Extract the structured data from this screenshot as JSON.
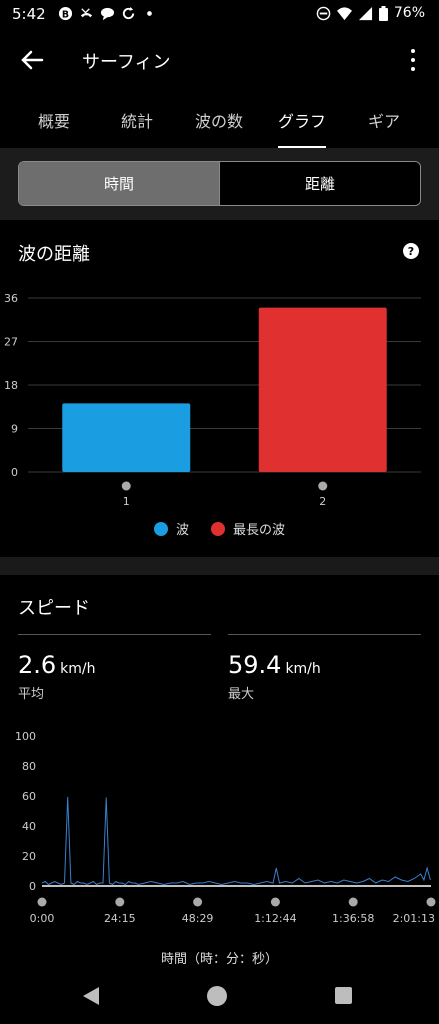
{
  "status_bar": {
    "time": "5:42",
    "battery": "76%",
    "left_icons": [
      "notification-b-icon",
      "missed-call-icon",
      "chat-icon",
      "sync-icon",
      "dot-icon"
    ],
    "right_icons": [
      "do-not-disturb-icon",
      "wifi-icon",
      "signal-icon",
      "battery-icon"
    ]
  },
  "app_bar": {
    "title": "サーフィン"
  },
  "tabs": [
    {
      "label": "概要"
    },
    {
      "label": "統計"
    },
    {
      "label": "波の数"
    },
    {
      "label": "グラフ",
      "active": true
    },
    {
      "label": "ギア"
    }
  ],
  "segmented": {
    "selected": "時間",
    "other": "距離"
  },
  "wave_distance": {
    "title": "波の距離",
    "chart_data": {
      "type": "bar",
      "categories": [
        "1",
        "2"
      ],
      "values": [
        14.2,
        34
      ],
      "ylim": [
        0,
        36
      ],
      "yticks": [
        "0",
        "9",
        "18",
        "27",
        "36"
      ],
      "colors": [
        "#1a9de1",
        "#e03030"
      ],
      "grid": true,
      "legend_position": "bottom"
    },
    "legend": [
      {
        "label": "波",
        "color": "#1a9de1"
      },
      {
        "label": "最長の波",
        "color": "#e03030"
      }
    ]
  },
  "speed": {
    "title": "スピード",
    "avg": {
      "value": "2.6",
      "unit": "km/h",
      "label": "平均"
    },
    "max": {
      "value": "59.4",
      "unit": "km/h",
      "label": "最大"
    },
    "chart_data": {
      "type": "line",
      "ylim": [
        0,
        100
      ],
      "yticks": [
        "0",
        "20",
        "40",
        "60",
        "80",
        "100"
      ],
      "xticks": [
        "0:00",
        "24:15",
        "48:29",
        "1:12:44",
        "1:36:58",
        "2:01:13"
      ],
      "xlabel": "時間（時：分：秒）",
      "series": [
        {
          "color": "#3a7fd0",
          "x_minutes": [
            0,
            1,
            2,
            3,
            4,
            5,
            6,
            7,
            8,
            9,
            10,
            11,
            12,
            13,
            14,
            15,
            16,
            17,
            18,
            19,
            20,
            21,
            22,
            23,
            24,
            25,
            26,
            27,
            28,
            29,
            30,
            32,
            34,
            36,
            38,
            40,
            42,
            44,
            46,
            48,
            50,
            52,
            54,
            56,
            58,
            60,
            62,
            64,
            66,
            68,
            70,
            72,
            73,
            74,
            76,
            78,
            80,
            82,
            84,
            86,
            88,
            90,
            92,
            94,
            96,
            98,
            100,
            102,
            104,
            106,
            108,
            110,
            112,
            114,
            116,
            118,
            119,
            120,
            121
          ],
          "values": [
            2,
            3,
            1,
            2,
            3,
            2,
            1,
            2,
            59.4,
            2,
            1,
            3,
            2,
            2,
            1,
            2,
            3,
            1,
            2,
            2,
            59,
            2,
            1,
            3,
            2,
            2,
            1,
            3,
            2,
            2,
            1,
            2,
            3,
            2,
            1,
            2,
            2,
            3,
            1,
            2,
            2,
            3,
            2,
            1,
            2,
            3,
            2,
            2,
            1,
            2,
            3,
            2,
            12,
            2,
            3,
            2,
            5,
            2,
            3,
            4,
            2,
            3,
            2,
            4,
            3,
            2,
            3,
            5,
            2,
            4,
            3,
            6,
            4,
            3,
            5,
            8,
            4,
            12,
            4
          ]
        }
      ]
    }
  },
  "nav_bar": {
    "icons": [
      "nav-back-icon",
      "nav-home-icon",
      "nav-recent-icon"
    ]
  }
}
